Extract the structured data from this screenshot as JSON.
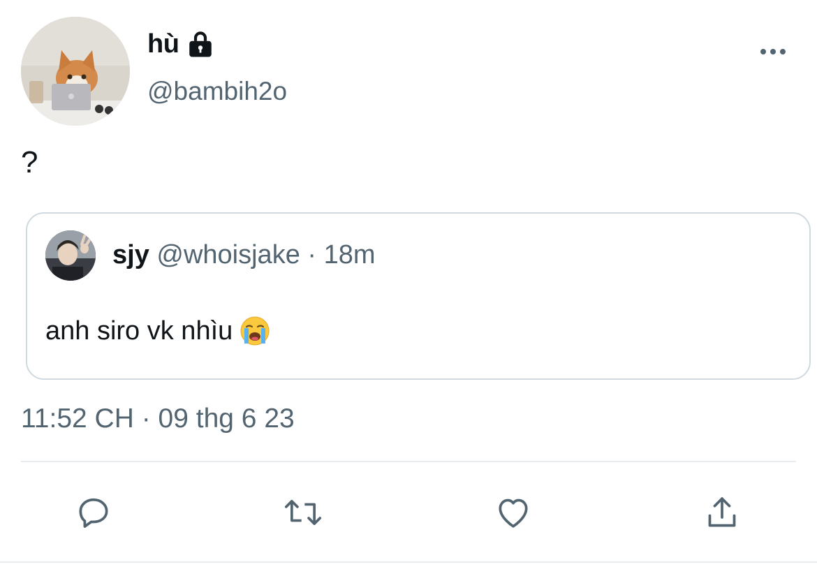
{
  "author": {
    "display_name": "hù",
    "handle": "@bambih2o",
    "locked_icon": "lock-icon",
    "avatar": "cat-with-laptop-avatar"
  },
  "tweet": {
    "text": "?"
  },
  "quoted_tweet": {
    "display_name": "sjy",
    "handle": "@whoisjake",
    "separator": "·",
    "time": "18m",
    "text": "anh siro vk nhìu",
    "emoji": "loudly-crying-face"
  },
  "timestamp": "11:52 CH · 09 thg 6 23",
  "actions": [
    "reply-icon",
    "retweet-icon",
    "like-icon",
    "share-icon"
  ],
  "colors": {
    "text": "#0f1419",
    "secondary": "#536471",
    "border": "#cfd9de",
    "divider": "#e6ecf0"
  }
}
